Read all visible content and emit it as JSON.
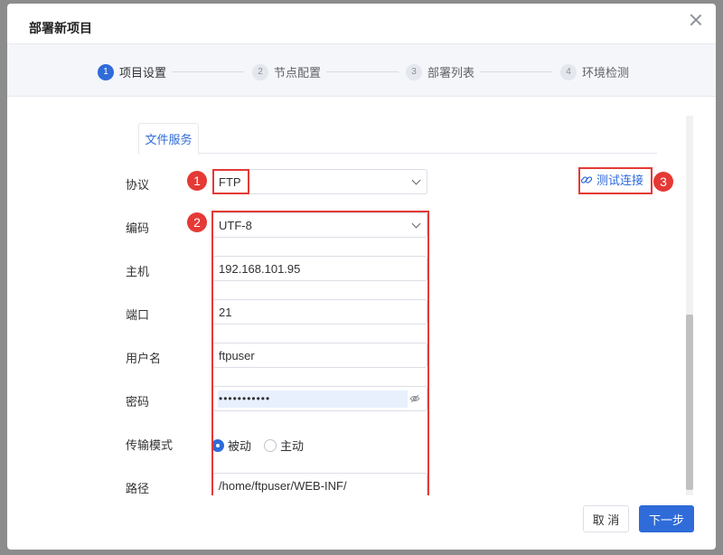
{
  "dialog": {
    "title": "部署新项目",
    "close_icon": "close-icon"
  },
  "steps": [
    {
      "num": "1",
      "label": "项目设置",
      "active": true
    },
    {
      "num": "2",
      "label": "节点配置",
      "active": false
    },
    {
      "num": "3",
      "label": "部署列表",
      "active": false
    },
    {
      "num": "4",
      "label": "环境检测",
      "active": false
    }
  ],
  "tab": {
    "label": "文件服务"
  },
  "form": {
    "protocol": {
      "label": "协议",
      "value": "FTP"
    },
    "encoding": {
      "label": "编码",
      "value": "UTF-8"
    },
    "host": {
      "label": "主机",
      "value": "192.168.101.95"
    },
    "port": {
      "label": "端口",
      "value": "21"
    },
    "username": {
      "label": "用户名",
      "value": "ftpuser"
    },
    "password": {
      "label": "密码",
      "value": "•••••••••••"
    },
    "transfer_mode": {
      "label": "传输模式",
      "options": [
        "被动",
        "主动"
      ],
      "selected": "被动"
    },
    "path": {
      "label": "路径",
      "value": "/home/ftpuser/WEB-INF/"
    }
  },
  "test_connection": {
    "label": "测试连接",
    "icon": "link-icon"
  },
  "annotations": [
    "1",
    "2",
    "3"
  ],
  "footer": {
    "cancel_label": "取 消",
    "next_label": "下一步"
  },
  "colors": {
    "accent": "#2f6bd9",
    "annotation": "#e53935"
  }
}
